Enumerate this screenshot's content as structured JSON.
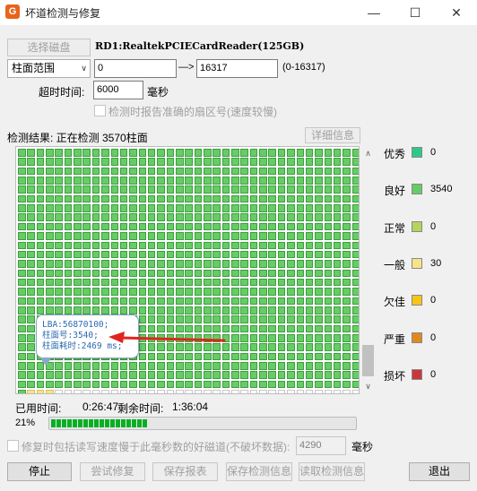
{
  "window": {
    "title": "坏道检测与修复",
    "app_icon": "app-logo-icon",
    "minimize": "—",
    "maximize": "☐",
    "close": "✕"
  },
  "toolbar": {
    "select_disk_label": "选择磁盘",
    "disk_name": "RD1:RealtekPCIECardReader(125GB)",
    "range_mode": "柱面范围",
    "range_start": "0",
    "range_arrow": "—>",
    "range_end": "16317",
    "range_hint": "(0-16317)",
    "timeout_label": "超时时间:",
    "timeout_value": "6000",
    "timeout_unit": "毫秒",
    "accurate_sector_label": "检测时报告准确的扇区号(速度较慢)"
  },
  "result": {
    "header": "检测结果:  正在检测  3570柱面",
    "details_button": "详细信息"
  },
  "grid": {
    "colors": {
      "good": "#66cc66",
      "partial": "#f6e38a",
      "pending": "#ffffff"
    },
    "total_cells": 999,
    "good_count": 963,
    "partial_count": 3
  },
  "tooltip": {
    "lines": [
      "LBA:56870100;",
      "柱面号:3540;",
      "柱面耗时:2469 ms;"
    ],
    "arrow_color": "#e0251e"
  },
  "legend": [
    {
      "label": "优秀",
      "color": "#2ec98a",
      "count": "0"
    },
    {
      "label": "良好",
      "color": "#66cc66",
      "count": "3540"
    },
    {
      "label": "正常",
      "color": "#b6d45a",
      "count": "0"
    },
    {
      "label": "一般",
      "color": "#f6e38a",
      "count": "30"
    },
    {
      "label": "欠佳",
      "color": "#f5c518",
      "count": "0"
    },
    {
      "label": "严重",
      "color": "#e08a1e",
      "count": "0"
    },
    {
      "label": "损坏",
      "color": "#c8383a",
      "count": "0"
    }
  ],
  "status": {
    "elapsed_label": "已用时间:",
    "elapsed_value": "0:26:47",
    "remaining_label": "剩余时间:",
    "remaining_value": "1:36:04",
    "percent": "21%",
    "progress_fraction": 0.21
  },
  "repair": {
    "label": "修复时包括读写速度慢于此毫秒数的好磁道(不破坏数据):",
    "value": "4290",
    "unit": "毫秒"
  },
  "buttons": {
    "stop": "停止",
    "try_repair": "尝试修复",
    "save_report": "保存报表",
    "save_info": "保存检测信息",
    "load_info": "读取检测信息",
    "exit": "退出"
  }
}
